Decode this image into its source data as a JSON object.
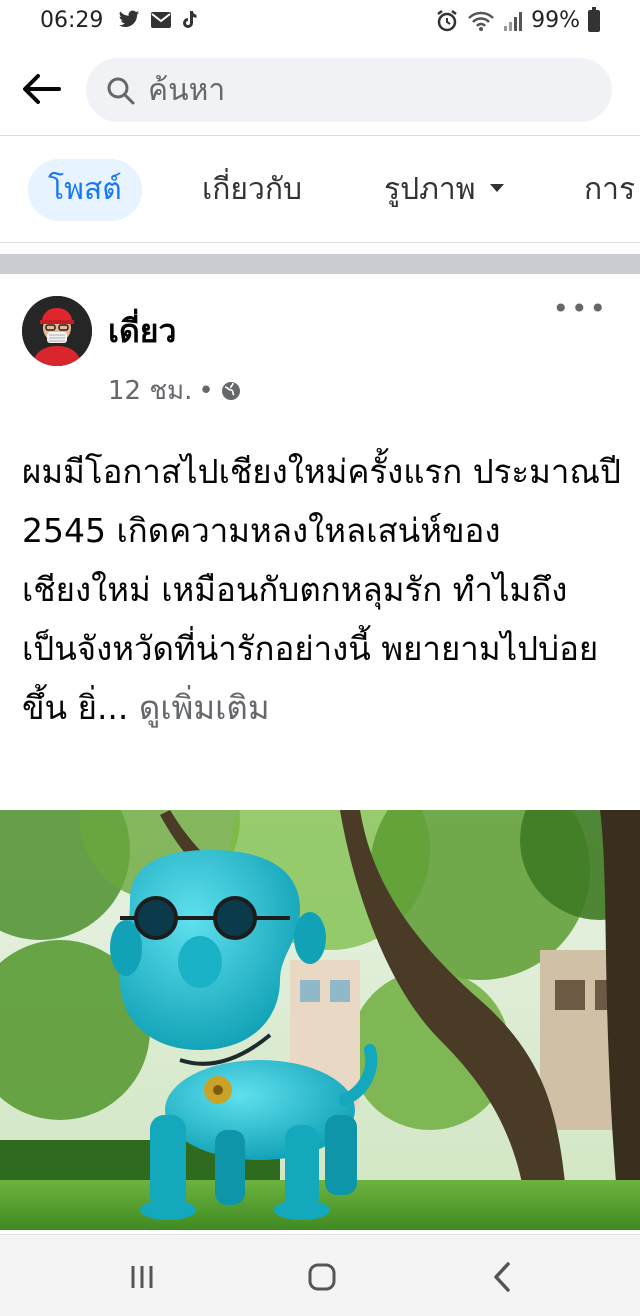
{
  "status_bar": {
    "time": "06:29",
    "battery": "99%",
    "left_icons": [
      "twitter-icon",
      "mail-icon",
      "tiktok-icon"
    ],
    "right_icons": [
      "alarm-icon",
      "wifi-icon",
      "signal-icon",
      "battery-icon"
    ]
  },
  "search": {
    "placeholder": "ค้นหา"
  },
  "tabs": {
    "posts": "โพสต์",
    "about": "เกี่ยวกับ",
    "photos": "รูปภาพ",
    "more": "การ"
  },
  "post": {
    "author": "เดี่ยว",
    "time": "12 ชม.",
    "separator": "•",
    "privacy_icon": "globe-icon",
    "text": "ผมมีโอกาสไปเชียงใหม่ครั้งแรก ประมาณปี 2545 เกิดความหลงใหลเสน่ห์ของเชียงใหม่ เหมือนกับตกหลุมรัก ทำไมถึงเป็นจังหวัดที่น่ารักอย่างนี้ พยายามไปบ่อยขึ้น ยิ่...",
    "see_more": "ดูเพิ่มเติม",
    "photo_description_icon": "photo-image"
  },
  "colors": {
    "accent": "#1877f2",
    "tab_active_bg": "#e7f3ff",
    "secondary_text": "#65676b",
    "statue": "#1fb5c9"
  }
}
